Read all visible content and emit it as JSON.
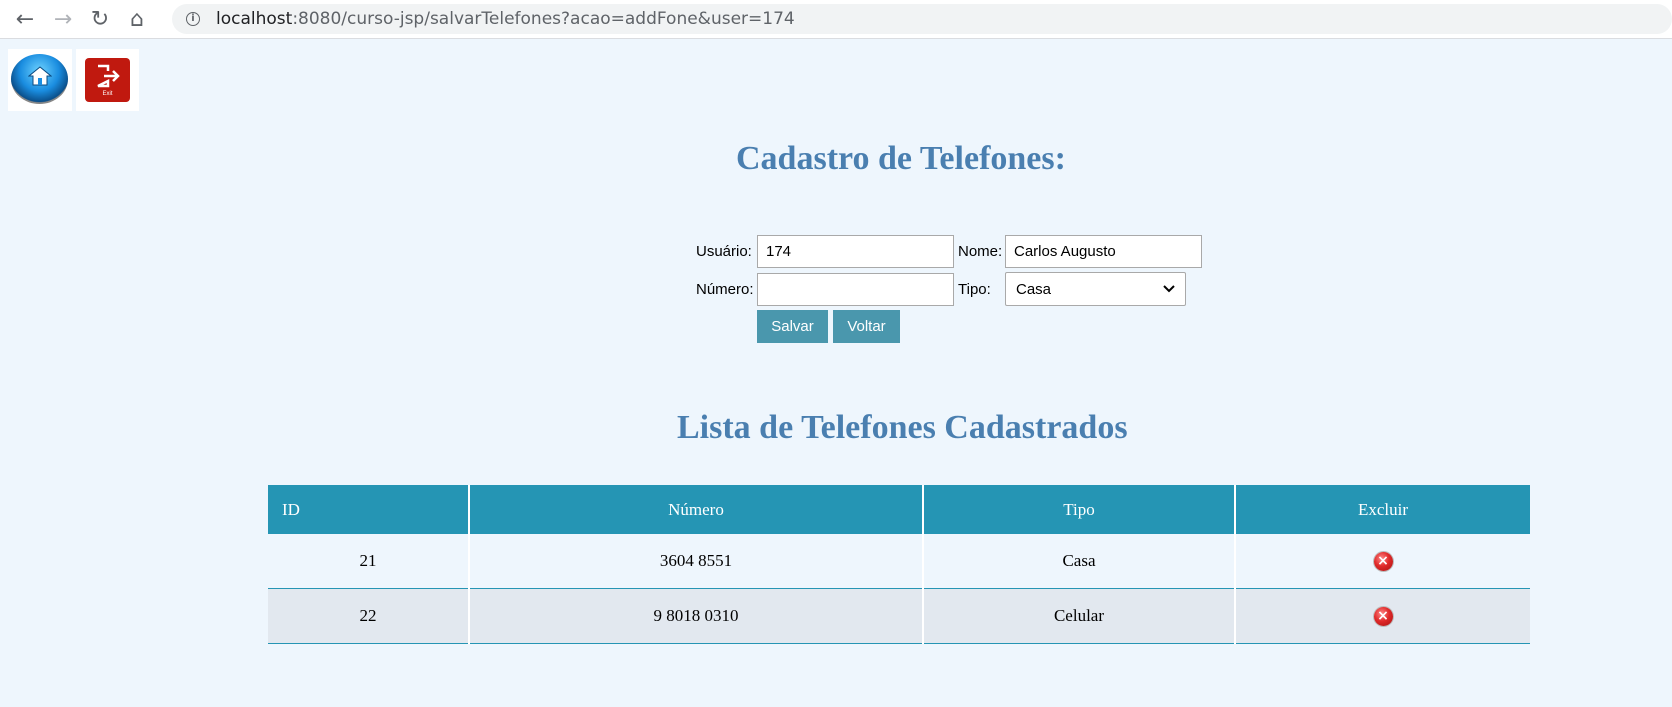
{
  "browser": {
    "url_host": "localhost",
    "url_rest": ":8080/curso-jsp/salvarTelefones?acao=addFone&user=174"
  },
  "header_icons": {
    "exit_text": "Exit"
  },
  "form": {
    "title": "Cadastro de Telefones:",
    "usuario_label": "Usuário:",
    "usuario_value": "174",
    "nome_label": "Nome:",
    "nome_value": "Carlos Augusto",
    "numero_label": "Número:",
    "numero_value": "",
    "tipo_label": "Tipo:",
    "tipo_selected": "Casa",
    "save_label": "Salvar",
    "back_label": "Voltar"
  },
  "list": {
    "title": "Lista de Telefones Cadastrados",
    "columns": [
      "ID",
      "Número",
      "Tipo",
      "Excluir"
    ],
    "rows": [
      {
        "id": "21",
        "numero": "3604 8551",
        "tipo": "Casa"
      },
      {
        "id": "22",
        "numero": "9 8018 0310",
        "tipo": "Celular"
      }
    ]
  },
  "colors": {
    "heading": "#4a7fb0",
    "table_header": "#2595b4",
    "button": "#4a97ad",
    "background": "#eef6fd"
  }
}
